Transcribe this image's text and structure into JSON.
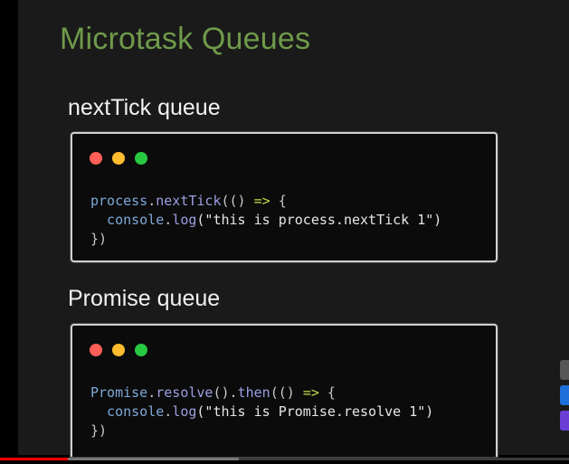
{
  "slide": {
    "title": "Microtask Queues",
    "sections": [
      {
        "heading": "nextTick queue",
        "code_lines": [
          [
            {
              "t": "process",
              "c": "obj"
            },
            {
              "t": ".",
              "c": "pun"
            },
            {
              "t": "nextTick",
              "c": "fn"
            },
            {
              "t": "(() ",
              "c": "pun"
            },
            {
              "t": "=>",
              "c": "arr"
            },
            {
              "t": " {",
              "c": "pun"
            }
          ],
          [
            {
              "t": "  console",
              "c": "obj"
            },
            {
              "t": ".",
              "c": "pun"
            },
            {
              "t": "log",
              "c": "fn"
            },
            {
              "t": "(\"this is process.nextTick 1\")",
              "c": "str"
            }
          ],
          [
            {
              "t": "})",
              "c": "pun"
            }
          ]
        ]
      },
      {
        "heading": "Promise queue",
        "code_lines": [
          [
            {
              "t": "Promise",
              "c": "obj"
            },
            {
              "t": ".",
              "c": "pun"
            },
            {
              "t": "resolve",
              "c": "fn"
            },
            {
              "t": "().",
              "c": "pun"
            },
            {
              "t": "then",
              "c": "fn"
            },
            {
              "t": "(() ",
              "c": "pun"
            },
            {
              "t": "=>",
              "c": "arr"
            },
            {
              "t": " {",
              "c": "pun"
            }
          ],
          [
            {
              "t": "  console",
              "c": "obj"
            },
            {
              "t": ".",
              "c": "pun"
            },
            {
              "t": "log",
              "c": "fn"
            },
            {
              "t": "(\"this is Promise.resolve 1\")",
              "c": "str"
            }
          ],
          [
            {
              "t": "})",
              "c": "pun"
            }
          ]
        ]
      }
    ]
  },
  "window_dots": [
    "#ff5f57",
    "#febc2e",
    "#28c840"
  ],
  "player": {
    "progress_percent": 12,
    "buffered_percent": 42,
    "side_widget_colors": [
      "#555555",
      "#1e6fd9",
      "#6b3fd6"
    ]
  }
}
